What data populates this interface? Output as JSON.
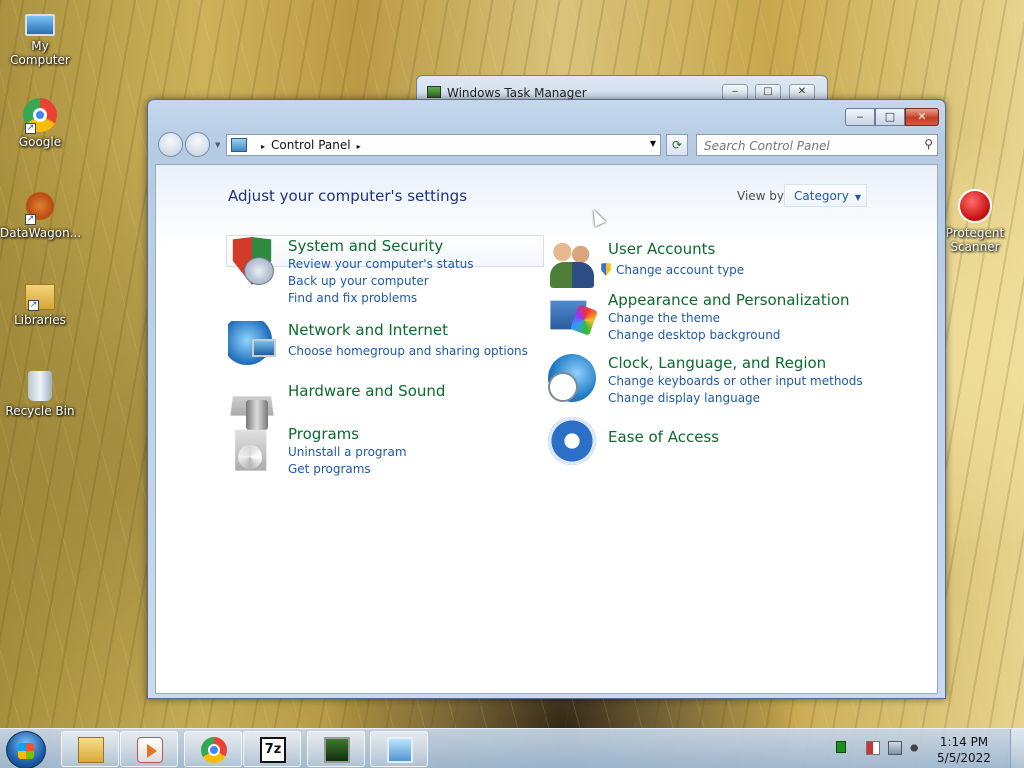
{
  "desktop": {
    "icons": [
      {
        "label": "My Computer",
        "icon": "computer-icon"
      },
      {
        "label": "Google",
        "icon": "chrome-icon"
      },
      {
        "label": "DataWagon...",
        "icon": "datawagon-icon"
      },
      {
        "label": "Libraries",
        "icon": "libraries-icon"
      },
      {
        "label": "Recycle Bin",
        "icon": "recycle-bin-icon"
      },
      {
        "label": "Protegent Scanner",
        "icon": "protegent-icon"
      }
    ]
  },
  "task_manager": {
    "title": "Windows Task Manager",
    "buttons": {
      "minimize": "‒",
      "maximize": "□",
      "close": "✕"
    }
  },
  "control_panel": {
    "caption_buttons": {
      "minimize": "‒",
      "maximize": "□",
      "close": "✕"
    },
    "address": {
      "breadcrumb": "Control Panel",
      "separator": "▸"
    },
    "search": {
      "placeholder": "Search Control Panel"
    },
    "heading": "Adjust your computer's settings",
    "view_by": {
      "label": "View by:",
      "value": "Category"
    },
    "categories_left": [
      {
        "title": "System and Security",
        "icon": "security-shield-icon",
        "links": [
          "Review your computer's status",
          "Back up your computer",
          "Find and fix problems"
        ]
      },
      {
        "title": "Network and Internet",
        "icon": "network-globe-icon",
        "links": [
          "Choose homegroup and sharing options"
        ]
      },
      {
        "title": "Hardware and Sound",
        "icon": "printer-speaker-icon",
        "links": []
      },
      {
        "title": "Programs",
        "icon": "programs-disc-icon",
        "links": [
          "Uninstall a program",
          "Get programs"
        ]
      }
    ],
    "categories_right": [
      {
        "title": "User Accounts",
        "icon": "users-icon",
        "links": [
          "Change account type"
        ]
      },
      {
        "title": "Appearance and Personalization",
        "icon": "appearance-palette-icon",
        "links": [
          "Change the theme",
          "Change desktop background"
        ]
      },
      {
        "title": "Clock, Language, and Region",
        "icon": "clock-globe-icon",
        "links": [
          "Change keyboards or other input methods",
          "Change display language"
        ]
      },
      {
        "title": "Ease of Access",
        "icon": "ease-of-access-icon",
        "links": []
      }
    ]
  },
  "taskbar": {
    "items": [
      "explorer-icon",
      "media-center-icon",
      "chrome-icon",
      "7zip-icon",
      "task-manager-icon",
      "control-panel-icon"
    ],
    "sevenzip_text": "7z",
    "clock": {
      "time": "1:14 PM",
      "date": "5/5/2022"
    }
  }
}
